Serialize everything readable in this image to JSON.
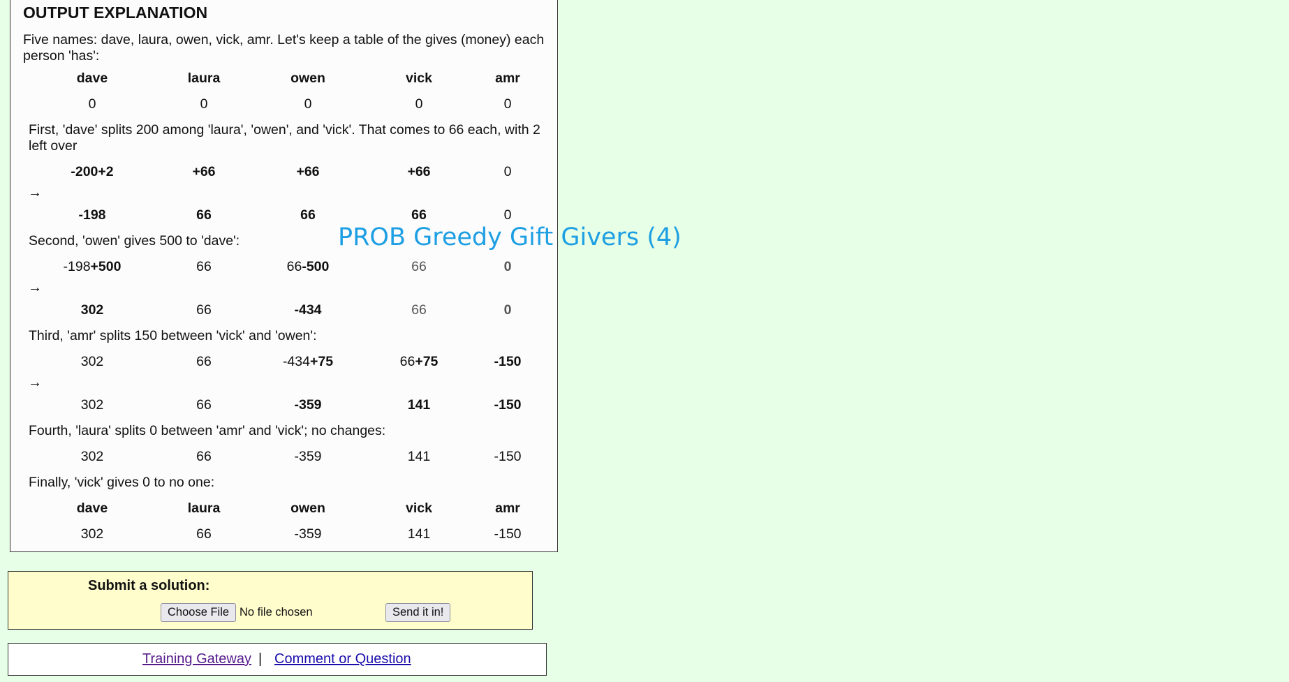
{
  "heading": "OUTPUT EXPLANATION",
  "intro": "Five names: dave, laura, owen, vick, amr. Let's keep a table of the gives (money) each person 'has':",
  "names": [
    "dave",
    "laura",
    "owen",
    "vick",
    "amr"
  ],
  "initial": [
    "0",
    "0",
    "0",
    "0",
    "0"
  ],
  "step1": {
    "text": "First, 'dave' splits 200 among 'laura', 'owen', and 'vick'. That comes to 66 each, with 2 left over",
    "changes": [
      "-200+2",
      "+66",
      "+66",
      "+66",
      "0"
    ],
    "result": [
      "-198",
      "66",
      "66",
      "66",
      "0"
    ]
  },
  "step2": {
    "text": "Second, 'owen' gives 500 to 'dave':",
    "changes": [
      {
        "base": "-198",
        "delta": "+500"
      },
      {
        "base": "66",
        "delta": ""
      },
      {
        "base": "66",
        "delta": "-500"
      },
      {
        "base": "66",
        "delta": ""
      },
      {
        "base": "0",
        "delta": ""
      }
    ],
    "result": [
      "302",
      "66",
      "-434",
      "66",
      "0"
    ]
  },
  "step3": {
    "text": "Third, 'amr' splits 150 between 'vick' and 'owen':",
    "changes": [
      {
        "base": "302",
        "delta": ""
      },
      {
        "base": "66",
        "delta": ""
      },
      {
        "base": "-434",
        "delta": "+75"
      },
      {
        "base": "66",
        "delta": "+75"
      },
      {
        "base": "",
        "delta": "-150"
      }
    ],
    "result": [
      "302",
      "66",
      "-359",
      "141",
      "-150"
    ]
  },
  "step4": {
    "text": "Fourth, 'laura' splits 0 between 'amr' and 'vick'; no changes:",
    "values": [
      "302",
      "66",
      "-359",
      "141",
      "-150"
    ]
  },
  "final": {
    "text": "Finally, 'vick' gives 0 to no one:",
    "values": [
      "302",
      "66",
      "-359",
      "141",
      "-150"
    ]
  },
  "arrow": "→",
  "overlay_title": "PROB Greedy Gift Givers (4)",
  "submit": {
    "title": "Submit a solution:",
    "choose_file": "Choose File",
    "no_file": "No file chosen",
    "send": "Send it in!"
  },
  "nav": {
    "training_gateway": "Training Gateway",
    "separator": "|",
    "comment": "Comment or Question"
  }
}
